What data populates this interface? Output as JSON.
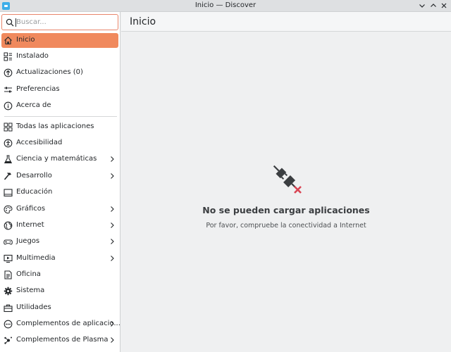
{
  "window": {
    "title": "Inicio — Discover"
  },
  "search": {
    "placeholder": "Buscar..."
  },
  "sidebar": {
    "top_items": [
      {
        "label": "Inicio",
        "icon": "home-icon",
        "active": true
      },
      {
        "label": "Instalado",
        "icon": "installed-icon"
      },
      {
        "label": "Actualizaciones (0)",
        "icon": "updates-icon"
      },
      {
        "label": "Preferencias",
        "icon": "preferences-icon"
      },
      {
        "label": "Acerca de",
        "icon": "info-icon"
      }
    ],
    "categories": [
      {
        "label": "Todas las aplicaciones",
        "icon": "grid-icon",
        "has_children": false
      },
      {
        "label": "Accesibilidad",
        "icon": "accessibility-icon",
        "has_children": false
      },
      {
        "label": "Ciencia y matemáticas",
        "icon": "flask-icon",
        "has_children": true
      },
      {
        "label": "Desarrollo",
        "icon": "hammer-icon",
        "has_children": true
      },
      {
        "label": "Educación",
        "icon": "education-icon",
        "has_children": false
      },
      {
        "label": "Gráficos",
        "icon": "graphics-icon",
        "has_children": true
      },
      {
        "label": "Internet",
        "icon": "globe-icon",
        "has_children": true
      },
      {
        "label": "Juegos",
        "icon": "gamepad-icon",
        "has_children": true
      },
      {
        "label": "Multimedia",
        "icon": "multimedia-icon",
        "has_children": true
      },
      {
        "label": "Oficina",
        "icon": "office-icon",
        "has_children": false
      },
      {
        "label": "Sistema",
        "icon": "gear-icon",
        "has_children": false
      },
      {
        "label": "Utilidades",
        "icon": "toolbox-icon",
        "has_children": false
      },
      {
        "label": "Complementos de aplicacio...",
        "icon": "ellipsis-icon",
        "has_children": true
      },
      {
        "label": "Complementos de Plasma",
        "icon": "plasma-icon",
        "has_children": true
      }
    ]
  },
  "main": {
    "title": "Inicio",
    "empty_state": {
      "icon": "disconnected-plug-icon",
      "title": "No se pueden cargar aplicaciones",
      "subtitle": "Por favor, compruebe la conectividad a Internet"
    }
  },
  "colors": {
    "accent": "#f0895d",
    "error": "#da4453",
    "search_border": "#e8856a"
  }
}
